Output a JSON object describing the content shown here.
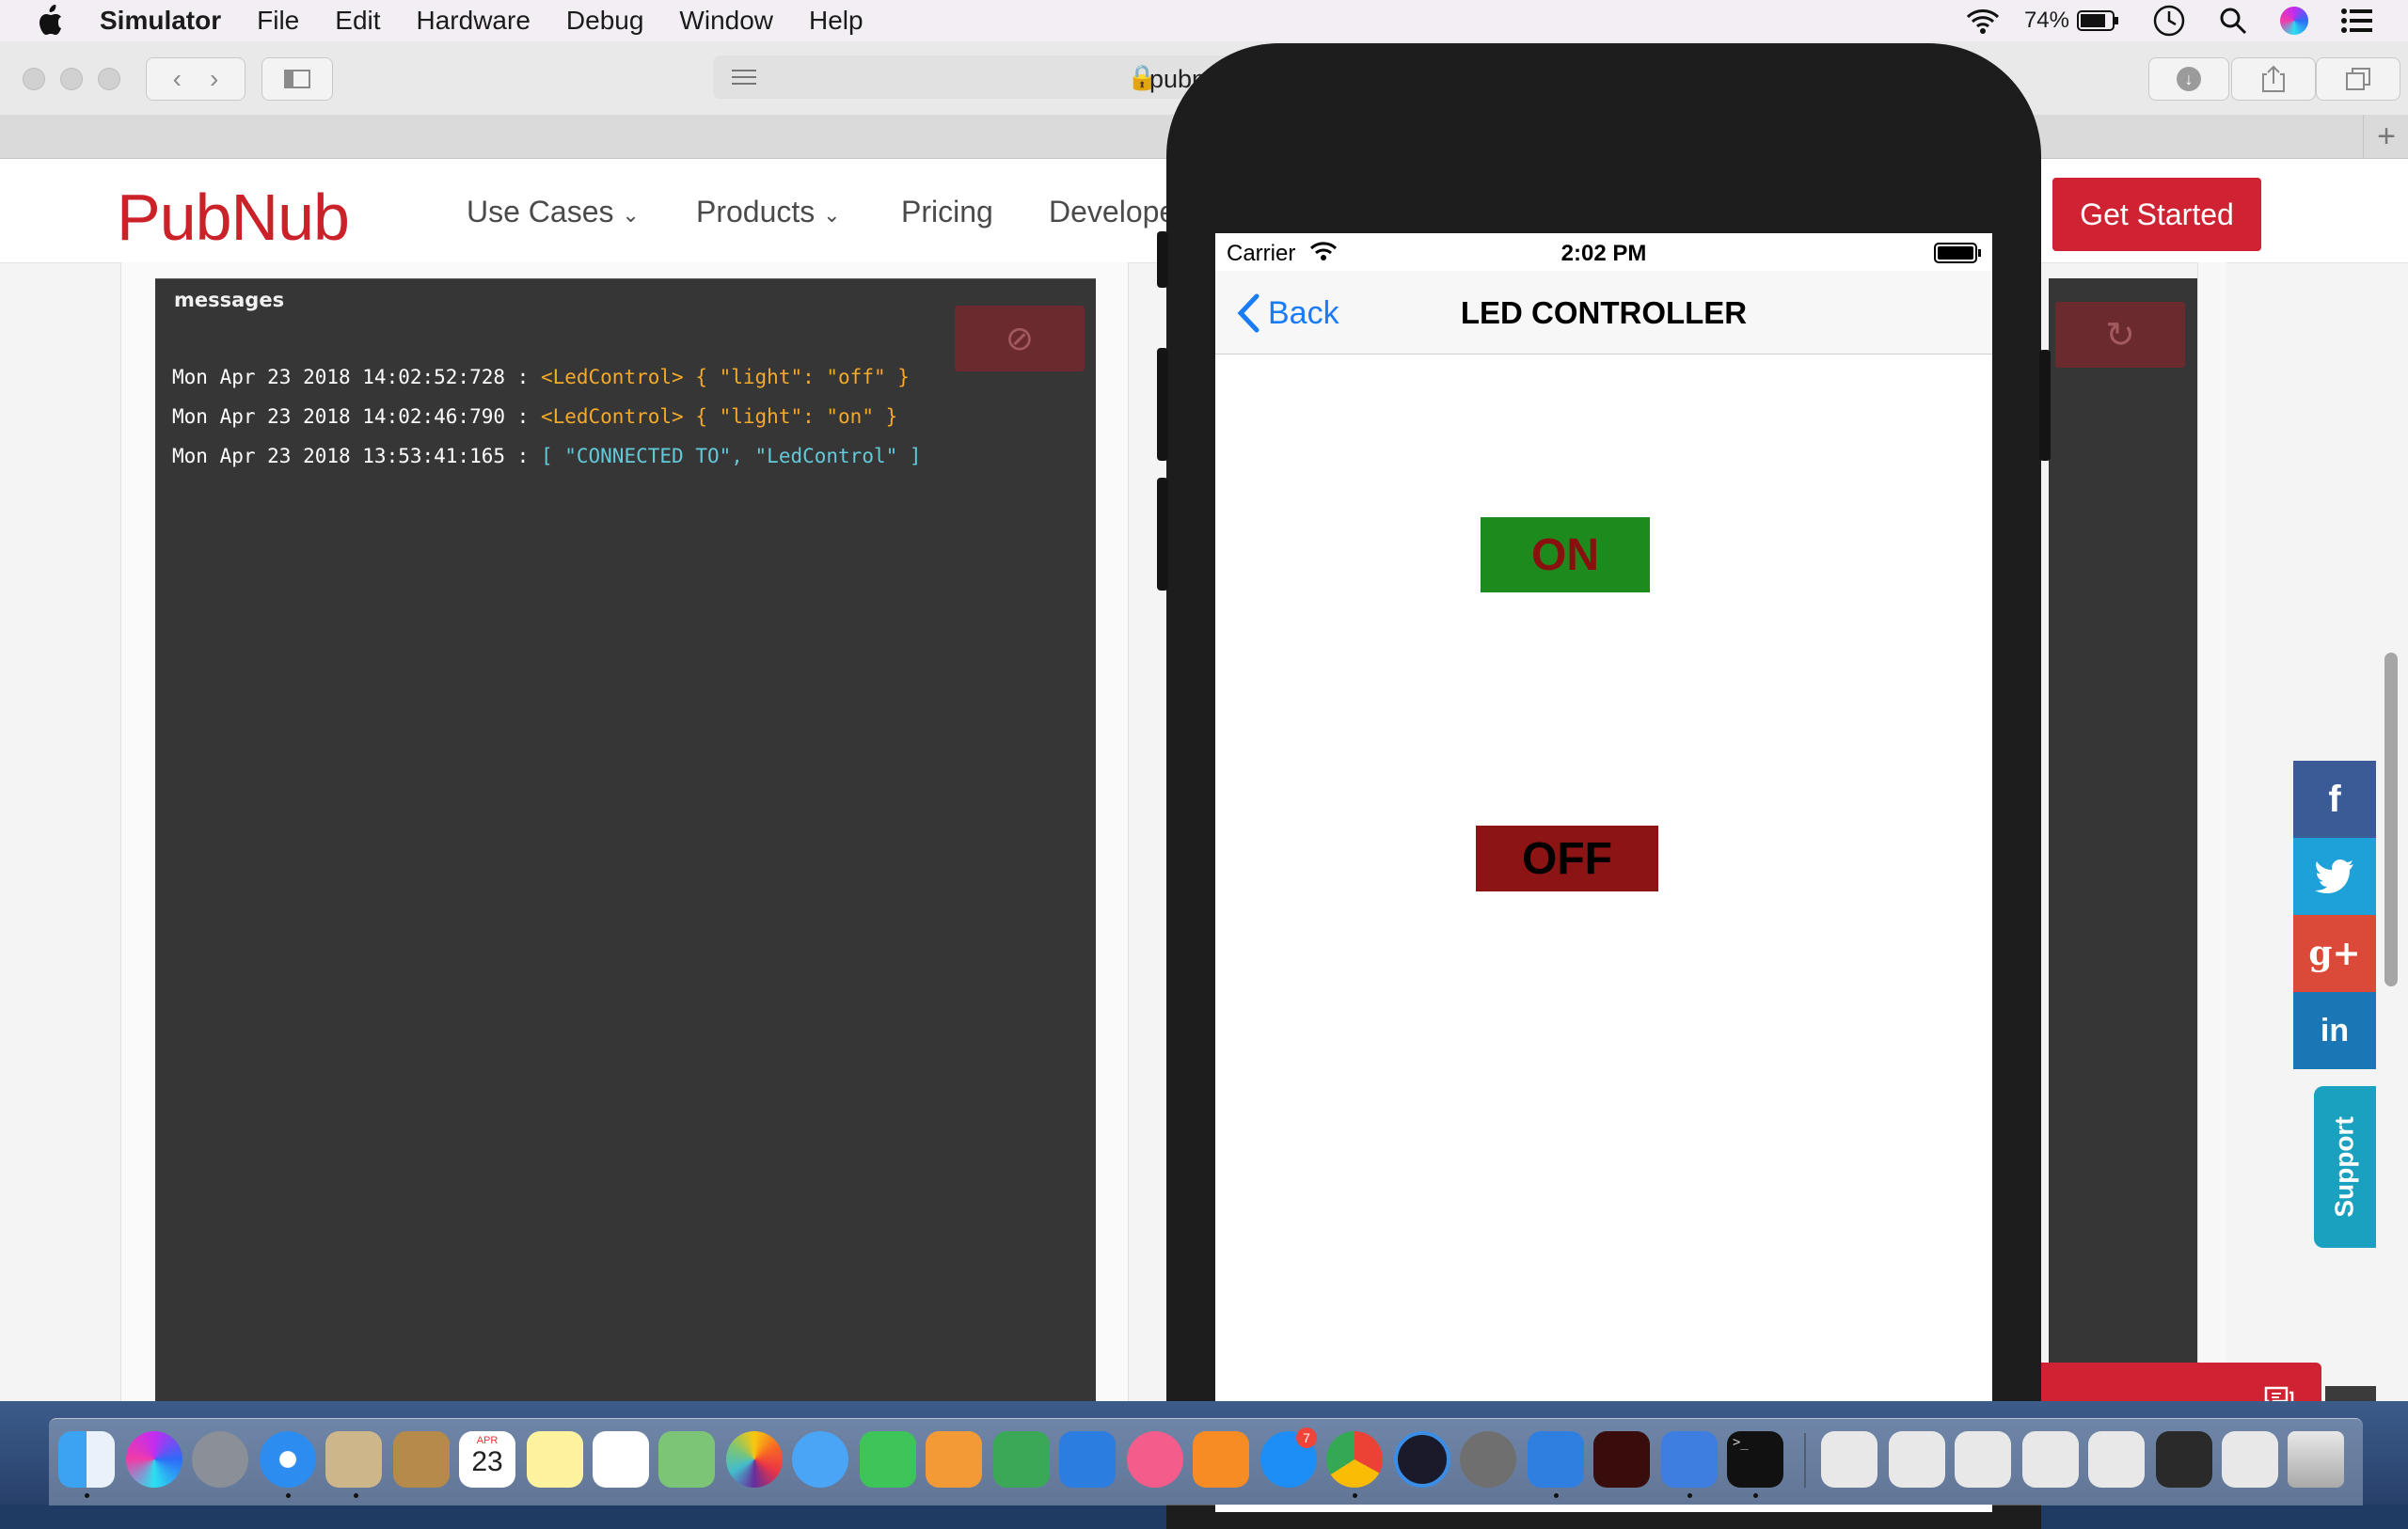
{
  "menubar": {
    "app": "Simulator",
    "items": [
      "File",
      "Edit",
      "Hardware",
      "Debug",
      "Window",
      "Help"
    ],
    "battery": "74%"
  },
  "safari": {
    "url_text": "pubn"
  },
  "pubnub": {
    "logo": "PubNub",
    "nav": [
      "Use Cases",
      "Products",
      "Pricing",
      "Develope"
    ],
    "get_started": "Get Started",
    "console_label": "messages",
    "log": [
      {
        "ts": "Mon Apr 23 2018 14:02:52:728 :",
        "msg": "<LedControl> { \"light\": \"off\" }",
        "color": "orange"
      },
      {
        "ts": "Mon Apr 23 2018 14:02:46:790 :",
        "msg": "<LedControl> { \"light\": \"on\" }",
        "color": "orange"
      },
      {
        "ts": "Mon Apr 23 2018 13:53:41:165 :",
        "msg": "[ \"CONNECTED TO\", \"LedControl\" ]",
        "color": "cyan"
      }
    ],
    "support": "Support",
    "social": [
      "f",
      "g+",
      "in"
    ]
  },
  "simulator": {
    "carrier": "Carrier",
    "time": "2:02 PM",
    "back": "Back",
    "title": "LED CONTROLLER",
    "on_label": "ON",
    "off_label": "OFF"
  },
  "dock": {
    "calendar_month": "APR",
    "calendar_day": "23",
    "appstore_badge": "7"
  },
  "colors": {
    "brand_red": "#cf2333",
    "on_green": "#1c8a1c",
    "off_red": "#8c1414",
    "ios_blue": "#1a7cf5"
  }
}
